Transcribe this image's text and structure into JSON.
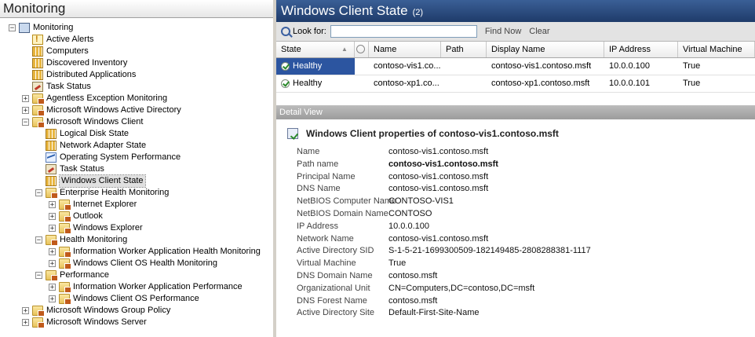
{
  "left_pane": {
    "title": "Monitoring",
    "tree": [
      {
        "label": "Monitoring",
        "indent": 0,
        "expander": "−",
        "icon": "monitor-icon"
      },
      {
        "label": "Active Alerts",
        "indent": 1,
        "expander": "",
        "icon": "alert-icon"
      },
      {
        "label": "Computers",
        "indent": 1,
        "expander": "",
        "icon": "grid-icon"
      },
      {
        "label": "Discovered Inventory",
        "indent": 1,
        "expander": "",
        "icon": "grid-icon"
      },
      {
        "label": "Distributed Applications",
        "indent": 1,
        "expander": "",
        "icon": "grid-icon"
      },
      {
        "label": "Task Status",
        "indent": 1,
        "expander": "",
        "icon": "task-icon"
      },
      {
        "label": "Agentless Exception Monitoring",
        "indent": 1,
        "expander": "+",
        "icon": "folder-icon"
      },
      {
        "label": "Microsoft Windows Active Directory",
        "indent": 1,
        "expander": "+",
        "icon": "folder-icon"
      },
      {
        "label": "Microsoft Windows Client",
        "indent": 1,
        "expander": "−",
        "icon": "folder-icon"
      },
      {
        "label": "Logical Disk State",
        "indent": 2,
        "expander": "",
        "icon": "grid-icon"
      },
      {
        "label": "Network Adapter State",
        "indent": 2,
        "expander": "",
        "icon": "grid-icon"
      },
      {
        "label": "Operating System Performance",
        "indent": 2,
        "expander": "",
        "icon": "perf-icon"
      },
      {
        "label": "Task Status",
        "indent": 2,
        "expander": "",
        "icon": "task-icon"
      },
      {
        "label": "Windows Client State",
        "indent": 2,
        "expander": "",
        "icon": "grid-icon",
        "selected": true
      },
      {
        "label": "Enterprise Health Monitoring",
        "indent": 2,
        "expander": "−",
        "icon": "folder-icon"
      },
      {
        "label": "Internet Explorer",
        "indent": 3,
        "expander": "+",
        "icon": "folder-icon"
      },
      {
        "label": "Outlook",
        "indent": 3,
        "expander": "+",
        "icon": "folder-icon"
      },
      {
        "label": "Windows Explorer",
        "indent": 3,
        "expander": "+",
        "icon": "folder-icon"
      },
      {
        "label": "Health Monitoring",
        "indent": 2,
        "expander": "−",
        "icon": "folder-icon"
      },
      {
        "label": "Information Worker Application Health Monitoring",
        "indent": 3,
        "expander": "+",
        "icon": "folder-icon"
      },
      {
        "label": "Windows Client OS Health Monitoring",
        "indent": 3,
        "expander": "+",
        "icon": "folder-icon"
      },
      {
        "label": "Performance",
        "indent": 2,
        "expander": "−",
        "icon": "folder-icon"
      },
      {
        "label": "Information Worker Application Performance",
        "indent": 3,
        "expander": "+",
        "icon": "folder-icon"
      },
      {
        "label": "Windows Client OS Performance",
        "indent": 3,
        "expander": "+",
        "icon": "folder-icon"
      },
      {
        "label": "Microsoft Windows Group Policy",
        "indent": 1,
        "expander": "+",
        "icon": "folder-icon"
      },
      {
        "label": "Microsoft Windows Server",
        "indent": 1,
        "expander": "+",
        "icon": "folder-icon"
      }
    ]
  },
  "right_pane": {
    "title": "Windows Client State",
    "count": "(2)",
    "toolbar": {
      "look_for_label": "Look for:",
      "search_value": "",
      "find_now": "Find Now",
      "clear": "Clear"
    },
    "columns": [
      "State",
      "Name",
      "Path",
      "Display Name",
      "IP Address",
      "Virtual Machine"
    ],
    "rows": [
      {
        "state": "Healthy",
        "name": "contoso-vis1.co...",
        "path": "",
        "display_name": "contoso-vis1.contoso.msft",
        "ip": "10.0.0.100",
        "vm": "True",
        "selected": true
      },
      {
        "state": "Healthy",
        "name": "contoso-xp1.co...",
        "path": "",
        "display_name": "contoso-xp1.contoso.msft",
        "ip": "10.0.0.101",
        "vm": "True",
        "selected": false
      }
    ],
    "detail_view": {
      "header": "Detail View",
      "title": "Windows Client properties of contoso-vis1.contoso.msft",
      "properties": [
        {
          "name": "Name",
          "value": "contoso-vis1.contoso.msft"
        },
        {
          "name": "Path name",
          "value": "contoso-vis1.contoso.msft",
          "bold": true
        },
        {
          "name": "Principal Name",
          "value": "contoso-vis1.contoso.msft"
        },
        {
          "name": "DNS Name",
          "value": "contoso-vis1.contoso.msft"
        },
        {
          "name": "NetBIOS Computer Name",
          "value": "CONTOSO-VIS1"
        },
        {
          "name": "NetBIOS Domain Name",
          "value": "CONTOSO"
        },
        {
          "name": "IP Address",
          "value": "10.0.0.100"
        },
        {
          "name": "Network Name",
          "value": "contoso-vis1.contoso.msft"
        },
        {
          "name": "Active Directory SID",
          "value": "S-1-5-21-1699300509-182149485-2808288381-1117"
        },
        {
          "name": "Virtual Machine",
          "value": "True"
        },
        {
          "name": "DNS Domain Name",
          "value": "contoso.msft"
        },
        {
          "name": "Organizational Unit",
          "value": "CN=Computers,DC=contoso,DC=msft"
        },
        {
          "name": "DNS Forest Name",
          "value": "contoso.msft"
        },
        {
          "name": "Active Directory Site",
          "value": "Default-First-Site-Name"
        }
      ]
    }
  },
  "colors": {
    "header_blue": "#1f3b6a",
    "selected_cell": "#2c55a0",
    "healthy_green": "#2a8a2a"
  }
}
